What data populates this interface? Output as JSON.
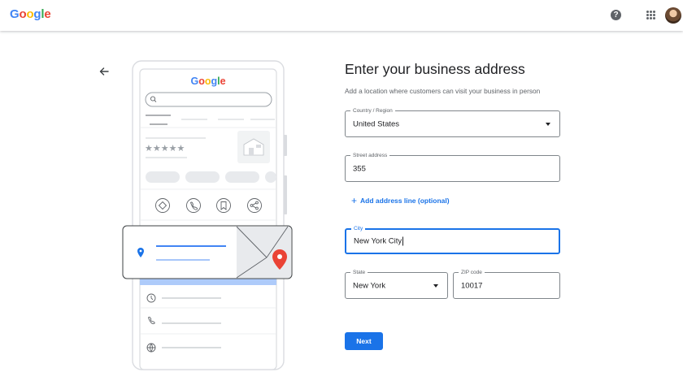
{
  "header": {
    "logo_letters": [
      "G",
      "o",
      "o",
      "g",
      "l",
      "e"
    ],
    "logo_colors": [
      "#4285F4",
      "#EA4335",
      "#FBBC05",
      "#4285F4",
      "#34A853",
      "#EA4335"
    ],
    "help_glyph": "?"
  },
  "illustration": {
    "phone_logo": "Google",
    "stars": "★★★★★"
  },
  "form": {
    "title": "Enter your business address",
    "subtitle": "Add a location where customers can visit your business in person",
    "country": {
      "label": "Country / Region",
      "value": "United States"
    },
    "street": {
      "label": "Street address",
      "value": "355"
    },
    "add_line": {
      "icon": "+",
      "label": "Add address line (optional)"
    },
    "city": {
      "label": "City",
      "value": "New York City"
    },
    "state": {
      "label": "State",
      "value": "New York"
    },
    "zip": {
      "label": "ZIP code",
      "value": "10017"
    },
    "next_label": "Next"
  },
  "colors": {
    "accent": "#1a73e8",
    "pin_red": "#EA4335",
    "pin_blue": "#4285F4"
  }
}
